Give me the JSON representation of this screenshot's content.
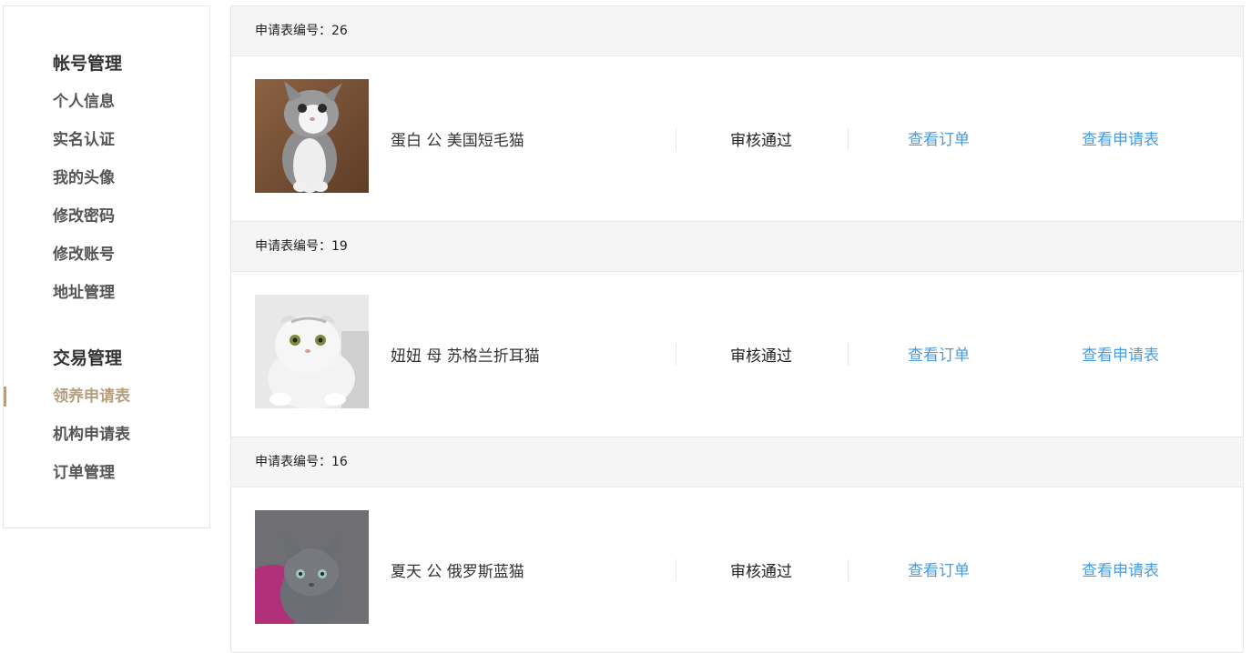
{
  "sidebar": {
    "account_group": {
      "title": "帐号管理",
      "items": [
        "个人信息",
        "实名认证",
        "我的头像",
        "修改密码",
        "修改账号",
        "地址管理"
      ]
    },
    "trade_group": {
      "title": "交易管理",
      "items": [
        "领养申请表",
        "机构申请表",
        "订单管理"
      ],
      "active": "领养申请表"
    },
    "accent_color": "#b59f7e"
  },
  "applications": [
    {
      "label": "申请表编号：26",
      "pet": "蛋白 公 美国短毛猫",
      "status": "审核通过",
      "view_order": "查看订单",
      "view_application": "查看申请表"
    },
    {
      "label": "申请表编号：19",
      "pet": "妞妞 母 苏格兰折耳猫",
      "status": "审核通过",
      "view_order": "查看订单",
      "view_application": "查看申请表"
    },
    {
      "label": "申请表编号：16",
      "pet": "夏天 公 俄罗斯蓝猫",
      "status": "审核通过",
      "view_order": "查看订单",
      "view_application": "查看申请表"
    }
  ],
  "colors": {
    "link": "#4a9bdc",
    "header_bg": "#f5f5f5"
  }
}
